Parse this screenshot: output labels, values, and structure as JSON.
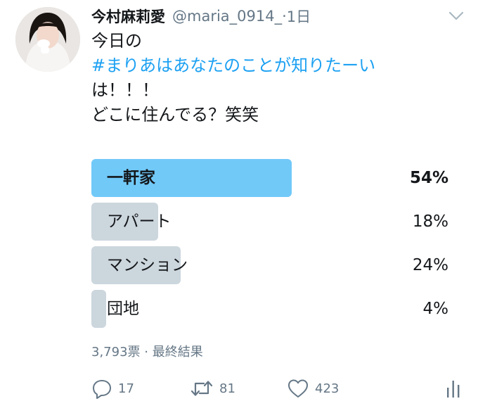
{
  "tweet": {
    "display_name": "今村麻莉愛",
    "handle": "@maria_0914_",
    "separator": "·",
    "time": "1日",
    "text_line1": "今日の",
    "hashtag": "#まりあはあなたのことが知りたーい",
    "text_line3": "は！！！",
    "text_line4": "どこに住んでる？笑笑"
  },
  "poll": {
    "options": [
      {
        "label": "一軒家",
        "percent_text": "54%",
        "percent": 54,
        "winner": true
      },
      {
        "label": "アパート",
        "percent_text": "18%",
        "percent": 18,
        "winner": false
      },
      {
        "label": "マンション",
        "percent_text": "24%",
        "percent": 24,
        "winner": false
      },
      {
        "label": "団地",
        "percent_text": "4%",
        "percent": 4,
        "winner": false
      }
    ],
    "votes_text": "3,793票",
    "separator": "·",
    "status_text": "最終結果"
  },
  "actions": {
    "reply_count": "17",
    "retweet_count": "81",
    "like_count": "423"
  },
  "colors": {
    "winner_bar": "#71c9f8",
    "loser_bar": "#ccd6dd",
    "link": "#1da1f2",
    "secondary_text": "#657786"
  },
  "icons": [
    "avatar",
    "chevron-down-icon",
    "reply-icon",
    "retweet-icon",
    "like-icon",
    "analytics-icon"
  ]
}
